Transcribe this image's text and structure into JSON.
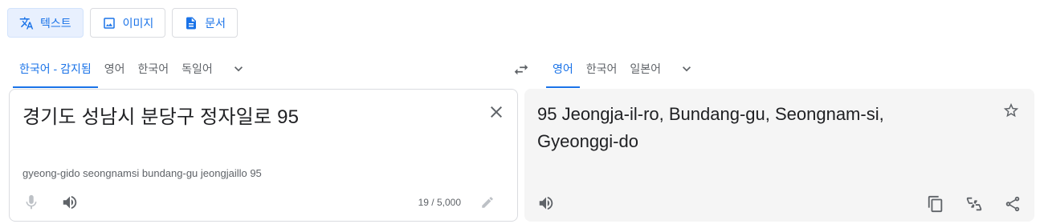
{
  "modes": [
    {
      "label": "텍스트",
      "icon": "translate-icon",
      "active": true
    },
    {
      "label": "이미지",
      "icon": "image-icon",
      "active": false
    },
    {
      "label": "문서",
      "icon": "document-icon",
      "active": false
    }
  ],
  "source_languages": {
    "tabs": [
      "한국어 - 감지됨",
      "영어",
      "한국어",
      "독일어"
    ],
    "active_index": 0,
    "more_icon": "chevron-down-icon"
  },
  "swap_icon": "swap-arrows-icon",
  "target_languages": {
    "tabs": [
      "영어",
      "한국어",
      "일본어"
    ],
    "active_index": 0,
    "more_icon": "chevron-down-icon"
  },
  "source_panel": {
    "text": "경기도 성남시 분당구 정자일로 95",
    "romanization": "gyeong-gido seongnamsi bundang-gu jeongjaillo 95",
    "char_count": "19 / 5,000",
    "icons": [
      "microphone-icon",
      "speaker-icon",
      "clear-icon",
      "pencil-icon"
    ]
  },
  "target_panel": {
    "text": "95 Jeongja-il-ro, Bundang-gu, Seongnam-si, Gyeonggi-do",
    "icons": [
      "star-icon",
      "speaker-icon",
      "copy-icon",
      "feedback-icon",
      "share-icon"
    ]
  },
  "colors": {
    "accent": "#1a73e8",
    "icon_gray": "#5f6368",
    "target_bg": "#f5f5f5",
    "active_mode_bg": "#e8f0fe"
  }
}
